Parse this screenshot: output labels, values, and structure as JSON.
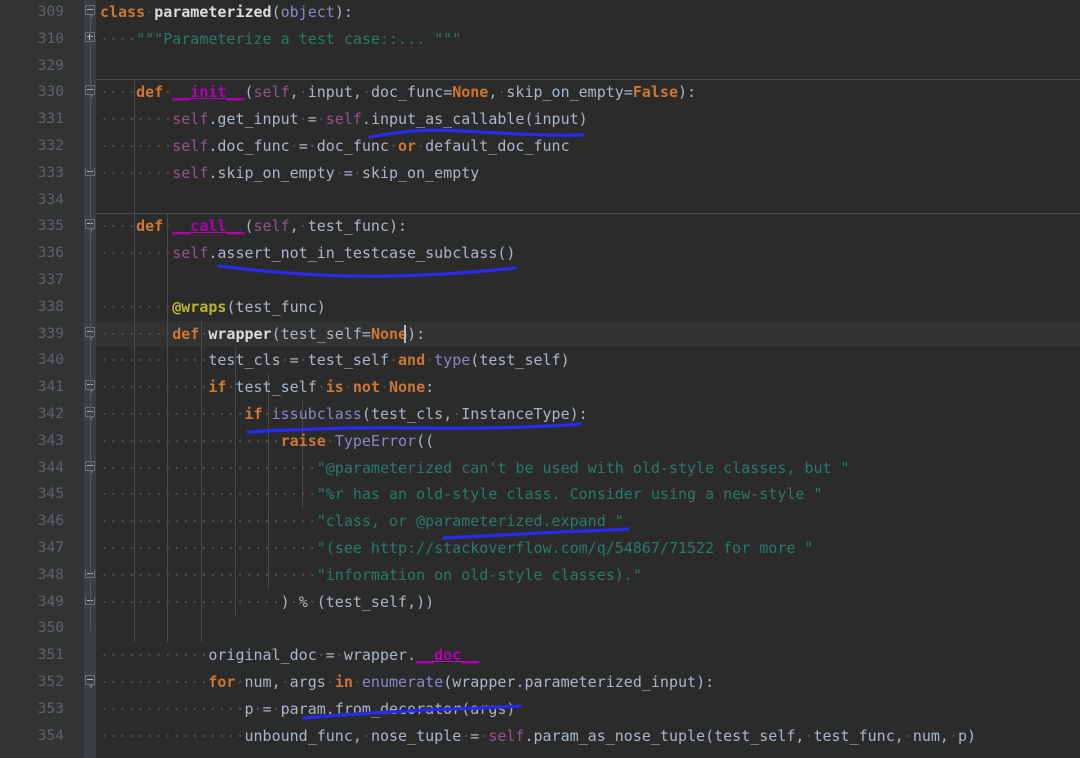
{
  "editor": {
    "theme_name": "darcula",
    "background": "#2b2b2b",
    "gutter_background": "#313335",
    "current_line_background": "#323232",
    "line_number_color": "#606366",
    "caret_color": "#bbbbbb",
    "annotation_ink_color": "#2a2aee",
    "font_size_px": 15,
    "line_height_px": 26.8,
    "current_line_number": "339",
    "collapsed_region_text": "\"\"\"Parameterize a test case::... \"\"\""
  },
  "lines": [
    {
      "num": "309",
      "text": "class parameterized(object):"
    },
    {
      "num": "310",
      "text": "    \"\"\"Parameterize a test case::... \"\"\""
    },
    {
      "num": "329",
      "text": ""
    },
    {
      "num": "330",
      "text": "    def __init__(self, input, doc_func=None, skip_on_empty=False):"
    },
    {
      "num": "331",
      "text": "        self.get_input = self.input_as_callable(input)"
    },
    {
      "num": "332",
      "text": "        self.doc_func = doc_func or default_doc_func"
    },
    {
      "num": "333",
      "text": "        self.skip_on_empty = skip_on_empty"
    },
    {
      "num": "334",
      "text": ""
    },
    {
      "num": "335",
      "text": "    def __call__(self, test_func):"
    },
    {
      "num": "336",
      "text": "        self.assert_not_in_testcase_subclass()"
    },
    {
      "num": "337",
      "text": ""
    },
    {
      "num": "338",
      "text": "        @wraps(test_func)"
    },
    {
      "num": "339",
      "text": "        def wrapper(test_self=None):"
    },
    {
      "num": "340",
      "text": "            test_cls = test_self and type(test_self)"
    },
    {
      "num": "341",
      "text": "            if test_self is not None:"
    },
    {
      "num": "342",
      "text": "                if issubclass(test_cls, InstanceType):"
    },
    {
      "num": "343",
      "text": "                    raise TypeError(("
    },
    {
      "num": "344",
      "text": "                        \"@parameterized can't be used with old-style classes, but \""
    },
    {
      "num": "345",
      "text": "                        \"%r has an old-style class. Consider using a new-style \""
    },
    {
      "num": "346",
      "text": "                        \"class, or @parameterized.expand \""
    },
    {
      "num": "347",
      "text": "                        \"(see http://stackoverflow.com/q/54867/71522 for more \""
    },
    {
      "num": "348",
      "text": "                        \"information on old-style classes).\""
    },
    {
      "num": "349",
      "text": "                    ) % (test_self,))"
    },
    {
      "num": "350",
      "text": ""
    },
    {
      "num": "351",
      "text": "            original_doc = wrapper.__doc__"
    },
    {
      "num": "352",
      "text": "            for num, args in enumerate(wrapper.parameterized_input):"
    },
    {
      "num": "353",
      "text": "                p = param.from_decorator(args)"
    },
    {
      "num": "354",
      "text": "                unbound_func, nose_tuple = self.param_as_nose_tuple(test_self, test_func, num, p)"
    }
  ],
  "annotations": [
    {
      "name": "underline-input-as-callable",
      "target_line": "331",
      "target_text": "input_as_callable(input)"
    },
    {
      "name": "underline-assert-not-in-testcase-subclass",
      "target_line": "336",
      "target_text": "assert_not_in_testcase_subclass()"
    },
    {
      "name": "underline-issubclass-instancetype",
      "target_line": "342",
      "target_text": "issubclass(test_cls, InstanceType)"
    },
    {
      "name": "underline-parameterized-expand",
      "target_line": "346",
      "target_text": "@parameterized.expand"
    },
    {
      "name": "underline-param-from-decorator",
      "target_line": "353",
      "target_text": "param.from_decorator(args)"
    }
  ],
  "fold_markers": [
    {
      "line": "309",
      "type": "open"
    },
    {
      "line": "310",
      "type": "plus"
    },
    {
      "line": "330",
      "type": "open"
    },
    {
      "line": "333",
      "type": "end"
    },
    {
      "line": "335",
      "type": "open"
    },
    {
      "line": "339",
      "type": "open"
    },
    {
      "line": "341",
      "type": "open"
    },
    {
      "line": "342",
      "type": "open"
    },
    {
      "line": "344",
      "type": "open"
    },
    {
      "line": "348",
      "type": "end"
    },
    {
      "line": "349",
      "type": "end"
    },
    {
      "line": "352",
      "type": "open"
    }
  ]
}
